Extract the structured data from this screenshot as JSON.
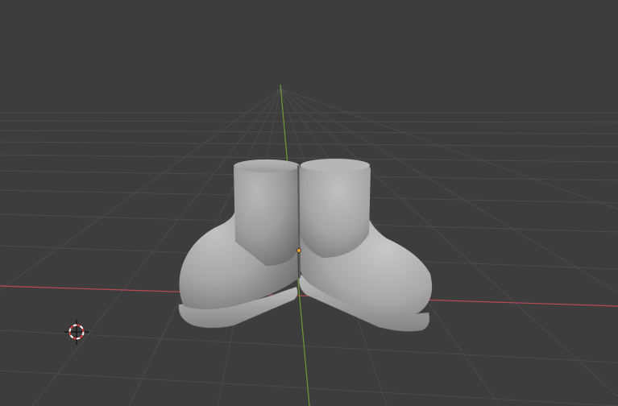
{
  "viewport": {
    "background": "#3d3d3d",
    "grid_color": "#4d4d4d",
    "x_axis_color": "#b84a53",
    "y_axis_color": "#6f9a36",
    "mesh_color": "#9a9a9a",
    "origin_color": "#f0a030"
  },
  "scene": {
    "objects": [
      {
        "name": "left-boot"
      },
      {
        "name": "right-boot"
      }
    ],
    "cursor_icon": "3d-cursor-icon",
    "origin_icon": "object-origin-icon"
  }
}
